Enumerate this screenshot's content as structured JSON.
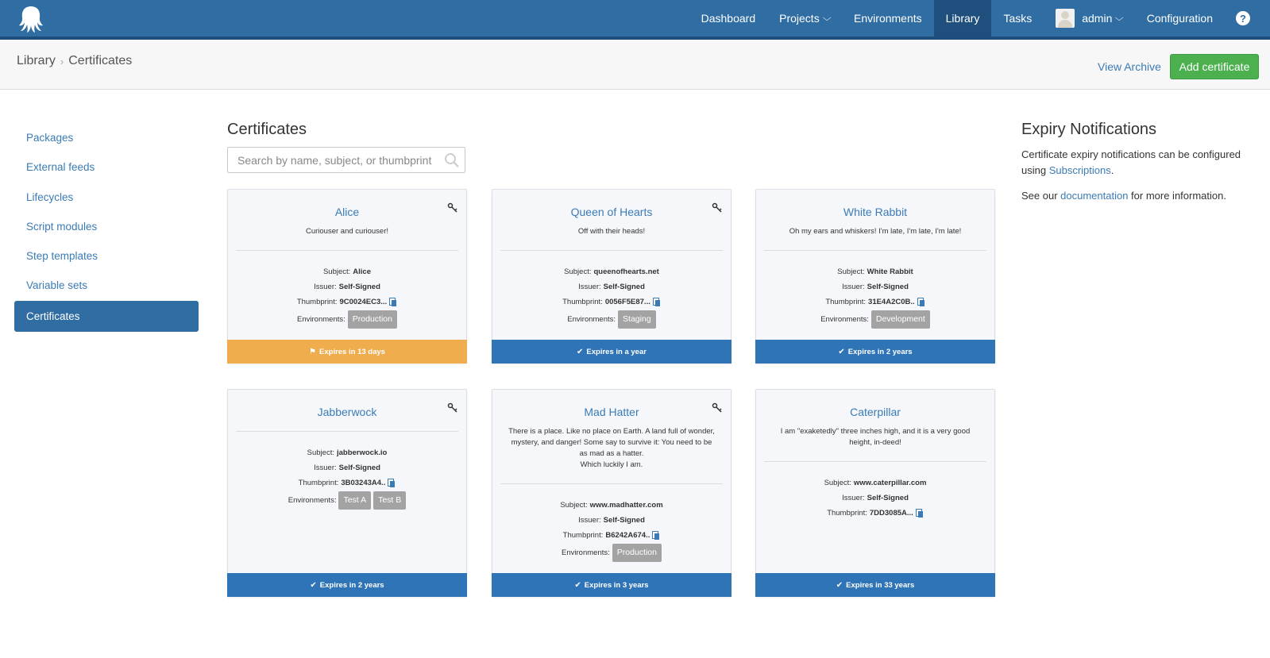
{
  "nav": {
    "items": [
      {
        "label": "Dashboard",
        "caret": false,
        "active": false
      },
      {
        "label": "Projects",
        "caret": true,
        "active": false
      },
      {
        "label": "Environments",
        "caret": false,
        "active": false
      },
      {
        "label": "Library",
        "caret": false,
        "active": true
      },
      {
        "label": "Tasks",
        "caret": false,
        "active": false
      }
    ],
    "user": "admin",
    "configuration": "Configuration",
    "help": "?"
  },
  "breadcrumb": {
    "parent": "Library",
    "separator": "›",
    "current": "Certificates"
  },
  "header": {
    "view_archive": "View Archive",
    "add_certificate": "Add certificate"
  },
  "sidebar": {
    "items": [
      {
        "label": "Packages",
        "active": false
      },
      {
        "label": "External feeds",
        "active": false
      },
      {
        "label": "Lifecycles",
        "active": false
      },
      {
        "label": "Script modules",
        "active": false
      },
      {
        "label": "Step templates",
        "active": false
      },
      {
        "label": "Variable sets",
        "active": false
      },
      {
        "label": "Certificates",
        "active": true
      }
    ]
  },
  "main": {
    "title": "Certificates",
    "search_placeholder": "Search by name, subject, or thumbprint"
  },
  "labels": {
    "subject": "Subject:",
    "issuer": "Issuer:",
    "thumbprint": "Thumbprint:",
    "environments": "Environments:"
  },
  "cards": [
    {
      "name": "Alice",
      "description": "Curiouser and curiouser!",
      "subject": "Alice",
      "issuer": "Self-Signed",
      "thumbprint": "9C0024EC3...",
      "environments": [
        "Production"
      ],
      "expires": "Expires in 13 days",
      "status": "warning",
      "has_key": true
    },
    {
      "name": "Queen of Hearts",
      "description": "Off with their heads!",
      "subject": "queenofhearts.net",
      "issuer": "Self-Signed",
      "thumbprint": "0056F5E87...",
      "environments": [
        "Staging"
      ],
      "expires": "Expires in a year",
      "status": "ok",
      "has_key": true
    },
    {
      "name": "White Rabbit",
      "description": "Oh my ears and whiskers! I'm late, I'm late, I'm late!",
      "subject": "White Rabbit",
      "issuer": "Self-Signed",
      "thumbprint": "31E4A2C0B..",
      "environments": [
        "Development"
      ],
      "expires": "Expires in 2 years",
      "status": "ok",
      "has_key": false
    },
    {
      "name": "Jabberwock",
      "description": "",
      "subject": "jabberwock.io",
      "issuer": "Self-Signed",
      "thumbprint": "3B03243A4..",
      "environments": [
        "Test A",
        "Test B"
      ],
      "expires": "Expires in 2 years",
      "status": "ok",
      "has_key": true
    },
    {
      "name": "Mad Hatter",
      "description": "There is a place. Like no place on Earth. A land full of wonder, mystery, and danger! Some say to survive it: You need to be as mad as a hatter.\nWhich luckily I am.",
      "subject": "www.madhatter.com",
      "issuer": "Self-Signed",
      "thumbprint": "B6242A674..",
      "environments": [
        "Production"
      ],
      "expires": "Expires in 3 years",
      "status": "ok",
      "has_key": true
    },
    {
      "name": "Caterpillar",
      "description": "I am \"exaketedly\" three inches high, and it is a very good height, in-deed!",
      "subject": "www.caterpillar.com",
      "issuer": "Self-Signed",
      "thumbprint": "7DD3085A...",
      "environments": [],
      "expires": "Expires in 33 years",
      "status": "ok",
      "has_key": false
    }
  ],
  "expiry": {
    "title": "Expiry Notifications",
    "text_before": "Certificate expiry notifications can be configured using ",
    "link_subscriptions": "Subscriptions",
    "text_after": ".",
    "p2_before": "See our ",
    "link_documentation": "documentation",
    "p2_after": " for more information."
  },
  "colors": {
    "nav": "#2f6da3",
    "accent": "#3b7bb5",
    "success": "#4cb04f",
    "warning": "#f0ad4e",
    "tag": "#a3a3a3"
  }
}
